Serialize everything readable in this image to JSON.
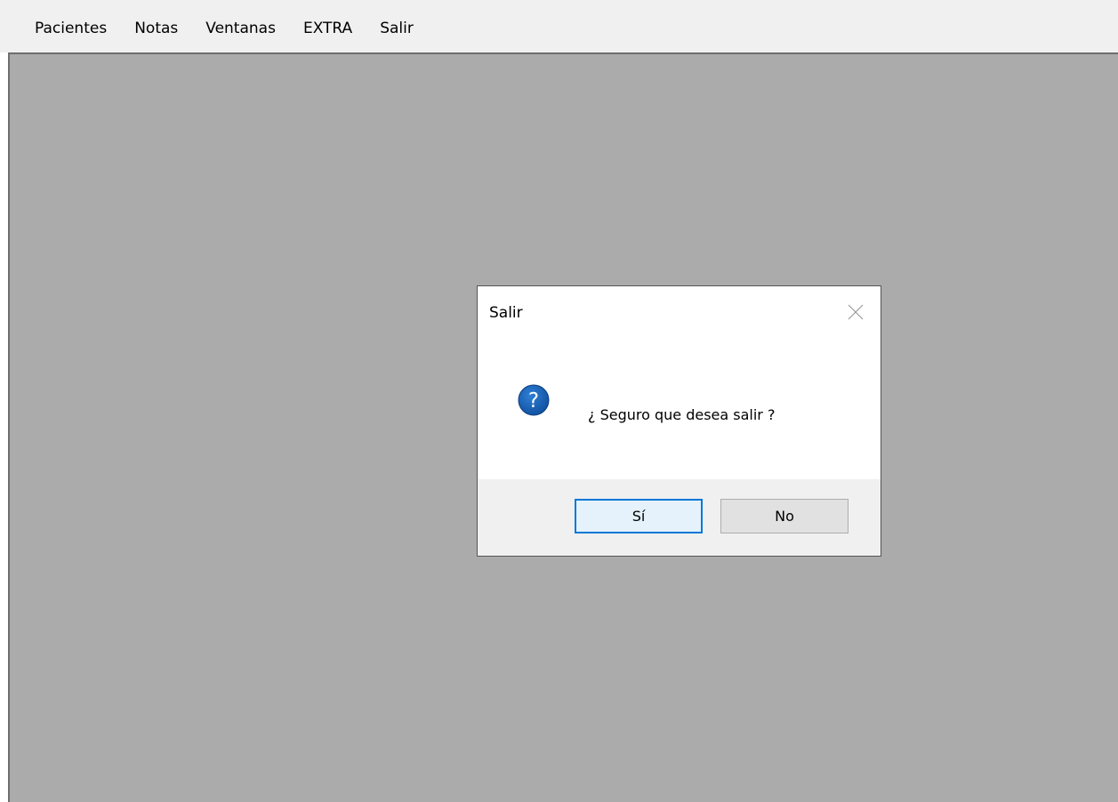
{
  "menubar": {
    "items": [
      {
        "label": "Pacientes"
      },
      {
        "label": "Notas"
      },
      {
        "label": "Ventanas"
      },
      {
        "label": "EXTRA"
      },
      {
        "label": "Salir"
      }
    ]
  },
  "dialog": {
    "title": "Salir",
    "message": "¿ Seguro que desea salir ?",
    "icon": "question-icon",
    "close_icon": "close-icon",
    "buttons": {
      "yes": "Sí",
      "no": "No"
    }
  },
  "colors": {
    "workspace": "#ababab",
    "menubar": "#f0f0f0",
    "accent": "#0078d7",
    "icon_blue": "#1a5fb4"
  }
}
